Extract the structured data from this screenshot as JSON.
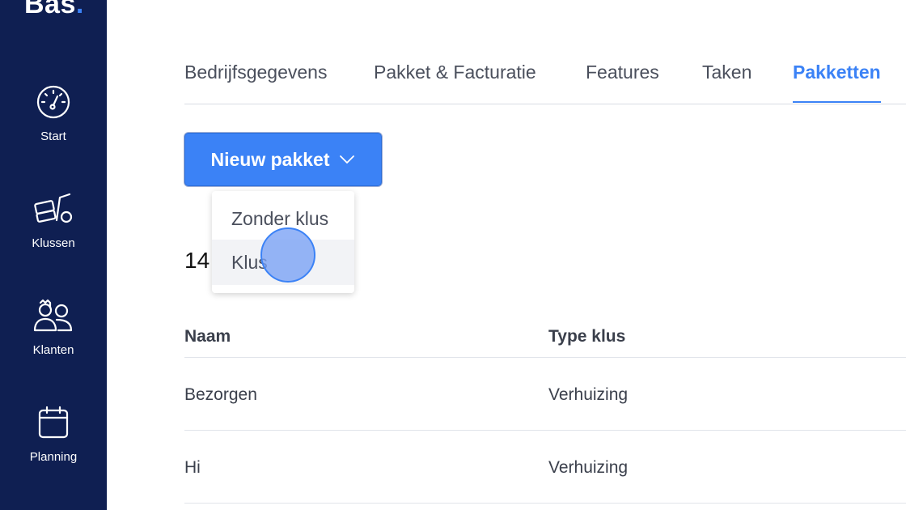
{
  "app": {
    "logo_text": "Bas",
    "logo_dot": ".",
    "accent": "#3b82f6",
    "sidebar_bg": "#0f1f52"
  },
  "sidebar": {
    "items": [
      {
        "label": "Start",
        "icon": "dashboard-gauge-icon"
      },
      {
        "label": "Klussen",
        "icon": "moving-dolly-icon"
      },
      {
        "label": "Klanten",
        "icon": "customers-icon"
      },
      {
        "label": "Planning",
        "icon": "calendar-icon"
      }
    ]
  },
  "tabs": [
    {
      "label": "Bedrijfsgegevens",
      "active": false
    },
    {
      "label": "Pakket & Facturatie",
      "active": false
    },
    {
      "label": "Features",
      "active": false
    },
    {
      "label": "Taken",
      "active": false
    },
    {
      "label": "Pakketten",
      "active": true
    }
  ],
  "new_package_button": {
    "label": "Nieuw pakket",
    "icon": "chevron-down-icon"
  },
  "dropdown": {
    "items": [
      {
        "label": "Zonder klus"
      },
      {
        "label": "Klus"
      }
    ]
  },
  "count": "14",
  "table": {
    "headers": [
      "Naam",
      "Type klus"
    ],
    "rows": [
      [
        "Bezorgen",
        "Verhuizing"
      ],
      [
        "Hi",
        "Verhuizing"
      ]
    ]
  }
}
